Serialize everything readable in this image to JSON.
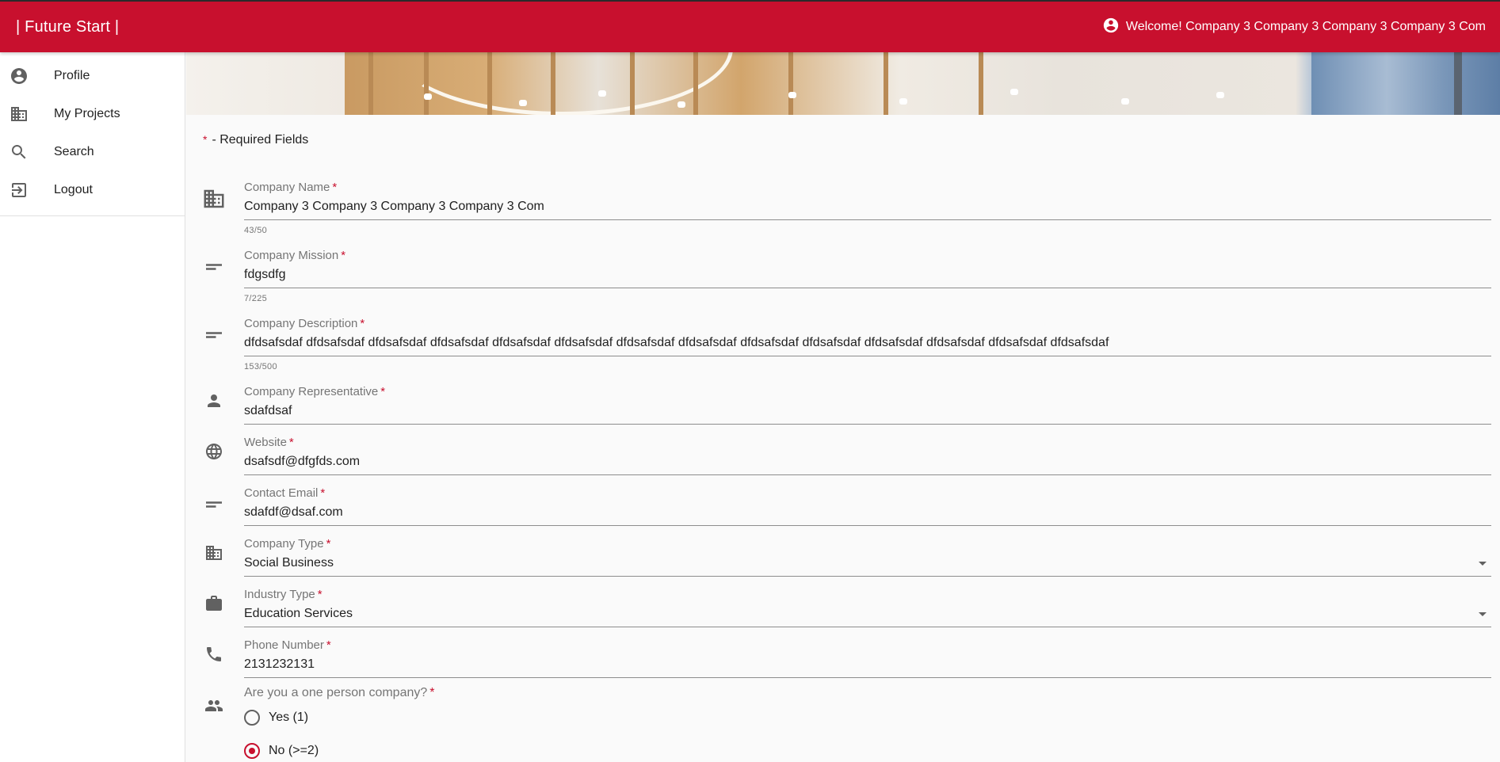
{
  "header": {
    "brand": "| Future Start |",
    "welcome": "Welcome! Company 3 Company 3 Company 3 Company 3 Com",
    "brand_color": "#c8102e"
  },
  "sidebar": {
    "items": [
      {
        "label": "Profile",
        "icon": "account-circle-icon"
      },
      {
        "label": "My Projects",
        "icon": "domain-icon"
      },
      {
        "label": "Search",
        "icon": "search-icon"
      },
      {
        "label": "Logout",
        "icon": "logout-icon"
      }
    ]
  },
  "form": {
    "required_star": "*",
    "required_note": "- Required Fields",
    "fields": {
      "company_name": {
        "label": "Company Name",
        "value": "Company 3 Company 3 Company 3 Company 3 Com",
        "counter": "43/50"
      },
      "company_mission": {
        "label": "Company Mission",
        "value": "fdgsdfg",
        "counter": "7/225"
      },
      "company_description": {
        "label": "Company Description",
        "value": "dfdsafsdaf dfdsafsdaf dfdsafsdaf dfdsafsdaf dfdsafsdaf dfdsafsdaf dfdsafsdaf dfdsafsdaf dfdsafsdaf dfdsafsdaf dfdsafsdaf dfdsafsdaf dfdsafsdaf dfdsafsdaf",
        "counter": "153/500"
      },
      "company_representative": {
        "label": "Company Representative",
        "value": "sdafdsaf"
      },
      "website": {
        "label": "Website",
        "value": "dsafsdf@dfgfds.com"
      },
      "contact_email": {
        "label": "Contact Email",
        "value": "sdafdf@dsaf.com"
      },
      "company_type": {
        "label": "Company Type",
        "value": "Social Business"
      },
      "industry_type": {
        "label": "Industry Type",
        "value": "Education Services"
      },
      "phone_number": {
        "label": "Phone Number",
        "value": "2131232131"
      }
    },
    "one_person": {
      "question": "Are you a one person company?",
      "options": [
        {
          "label": "Yes (1)",
          "checked": false
        },
        {
          "label": "No (>=2)",
          "checked": true
        }
      ]
    }
  }
}
